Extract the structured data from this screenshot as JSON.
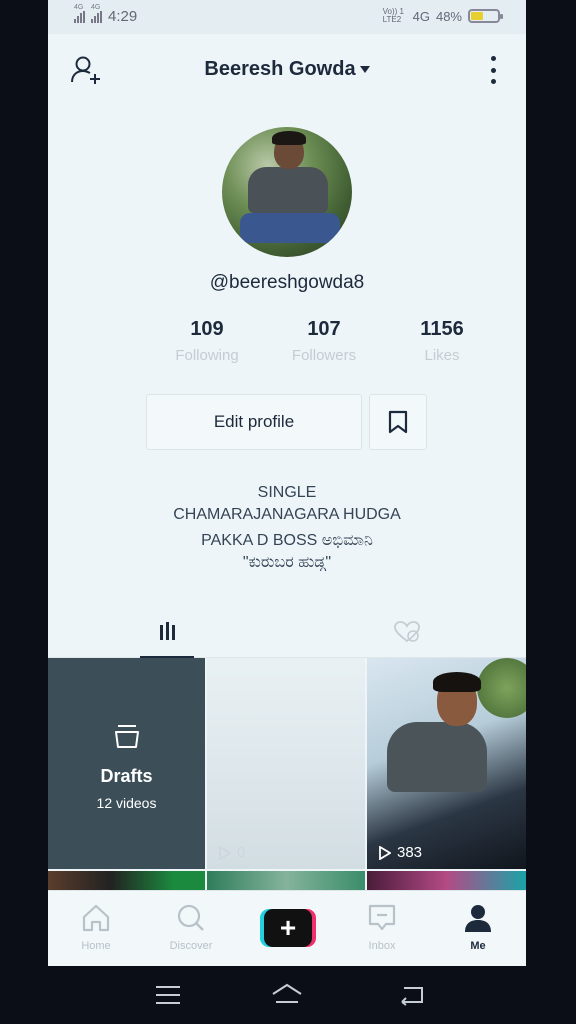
{
  "status_bar": {
    "signal1": "4G",
    "signal2": "4G",
    "time": "4:29",
    "volte": "Vo)) 1 LTE2",
    "network": "4G",
    "battery": "48%",
    "battery_level": 0.48
  },
  "header": {
    "name": "Beeresh Gowda",
    "add_user_icon": "add-user-icon",
    "more_icon": "more-vertical-icon"
  },
  "profile": {
    "handle": "@beereshgowda8",
    "stats": [
      {
        "value": "109",
        "label": "Following"
      },
      {
        "value": "107",
        "label": "Followers"
      },
      {
        "value": "1156",
        "label": "Likes"
      }
    ],
    "edit_label": "Edit profile",
    "bookmark_icon": "bookmark-icon",
    "bio": [
      "SINGLE",
      "CHAMARAJANAGARA HUDGA",
      "PAKKA D BOSS ಅಭಿಮಾನಿ",
      "\"ಕುರುಬರ ಹುಡ್ಗ\""
    ]
  },
  "tabs": {
    "videos_icon": "grid-icon",
    "liked_icon": "liked-heart-icon"
  },
  "grid": {
    "drafts_title": "Drafts",
    "drafts_count": "12 videos",
    "tile2_views": "0",
    "tile3_views": "383"
  },
  "bottom_nav": {
    "home": "Home",
    "discover": "Discover",
    "inbox": "Inbox",
    "me": "Me",
    "create": "+"
  },
  "colors": {
    "accent_cyan": "#22d0e0",
    "accent_pink": "#f0306a",
    "text_dark": "#1c2a3c"
  }
}
